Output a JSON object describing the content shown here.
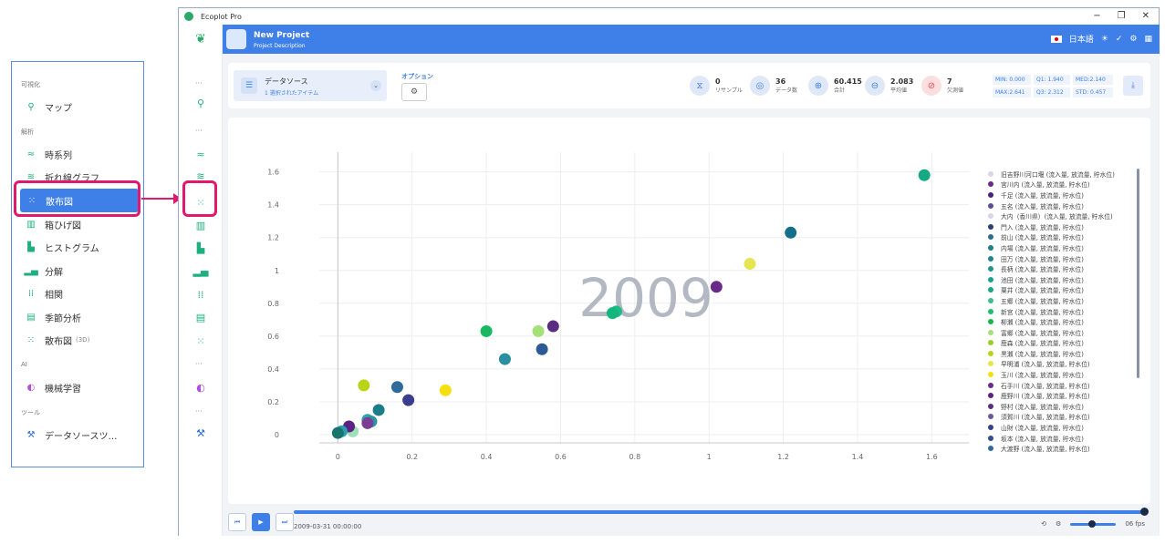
{
  "callout_menu": {
    "sections": [
      {
        "label": "可視化",
        "items": [
          {
            "label": "マップ",
            "icon": "map-pin-icon"
          }
        ]
      },
      {
        "label": "解析",
        "items": [
          {
            "label": "時系列",
            "icon": "timeseries-icon"
          },
          {
            "label": "折れ線グラフ",
            "icon": "line-chart-icon"
          },
          {
            "label": "散布図",
            "icon": "scatter-icon",
            "active": true
          },
          {
            "label": "箱ひげ図",
            "icon": "boxplot-icon"
          },
          {
            "label": "ヒストグラム",
            "icon": "histogram-icon"
          },
          {
            "label": "分解",
            "icon": "decompose-icon"
          },
          {
            "label": "相関",
            "icon": "correlation-icon"
          },
          {
            "label": "季節分析",
            "icon": "seasonal-icon"
          },
          {
            "label": "散布図",
            "sub": "(3D)",
            "icon": "scatter3d-icon"
          }
        ]
      },
      {
        "label": "AI",
        "items": [
          {
            "label": "機械学習",
            "icon": "ml-icon"
          }
        ]
      },
      {
        "label": "ツール",
        "items": [
          {
            "label": "データソースツ…",
            "icon": "tools-icon"
          }
        ]
      }
    ]
  },
  "window": {
    "title": "Ecoplot Pro",
    "controls": [
      "−",
      "❐",
      "✕"
    ]
  },
  "header": {
    "project_title": "New Project",
    "project_desc": "Project Description",
    "language": "日本語"
  },
  "toolbar": {
    "datasource_label": "データソース",
    "datasource_sub": "1 選択されたアイテム",
    "options_label": "オプション",
    "stats": [
      {
        "value": "0",
        "label": "リサンプル",
        "icon": "resample-icon"
      },
      {
        "value": "36",
        "label": "データ数",
        "icon": "count-icon"
      },
      {
        "value": "60.415",
        "label": "合計",
        "icon": "sum-icon"
      },
      {
        "value": "2.083",
        "label": "平均値",
        "icon": "mean-icon"
      },
      {
        "value": "7",
        "label": "欠測値",
        "icon": "missing-icon"
      }
    ],
    "metrics": [
      "MIN: 0.000",
      "Q1: 1.940",
      "MED:2.140",
      "MAX:2.641",
      "Q3: 2.312",
      "STD: 0.457"
    ]
  },
  "chart_data": {
    "type": "scatter",
    "annotation": "2009",
    "xlim": [
      -0.05,
      1.7
    ],
    "ylim": [
      -0.05,
      1.72
    ],
    "xticks": [
      0,
      0.2,
      0.4,
      0.6,
      0.8,
      1,
      1.2,
      1.4,
      1.6
    ],
    "yticks": [
      0,
      0.2,
      0.4,
      0.6,
      0.8,
      1,
      1.2,
      1.4,
      1.6
    ],
    "points": [
      {
        "x": 1.58,
        "y": 1.58,
        "color": "#17a884"
      },
      {
        "x": 1.22,
        "y": 1.23,
        "color": "#14708a"
      },
      {
        "x": 1.11,
        "y": 1.04,
        "color": "#e3e651"
      },
      {
        "x": 1.02,
        "y": 0.9,
        "color": "#6a2a8a"
      },
      {
        "x": 0.75,
        "y": 0.75,
        "color": "#1ebd87"
      },
      {
        "x": 0.74,
        "y": 0.74,
        "color": "#14b67e"
      },
      {
        "x": 0.58,
        "y": 0.66,
        "color": "#5a2d82"
      },
      {
        "x": 0.54,
        "y": 0.63,
        "color": "#a6e07a"
      },
      {
        "x": 0.4,
        "y": 0.63,
        "color": "#19b863"
      },
      {
        "x": 0.55,
        "y": 0.52,
        "color": "#2d5a94"
      },
      {
        "x": 0.45,
        "y": 0.46,
        "color": "#b7dc4f"
      },
      {
        "x": 0.45,
        "y": 0.46,
        "color": "#2a8fa0"
      },
      {
        "x": 0.29,
        "y": 0.27,
        "color": "#f6df0f"
      },
      {
        "x": 0.07,
        "y": 0.3,
        "color": "#b9d417"
      },
      {
        "x": 0.16,
        "y": 0.29,
        "color": "#2f6a9a"
      },
      {
        "x": 0.19,
        "y": 0.21,
        "color": "#3b3e8f"
      },
      {
        "x": 0.11,
        "y": 0.15,
        "color": "#1b7d8a"
      },
      {
        "x": 0.08,
        "y": 0.09,
        "color": "#32a4a8"
      },
      {
        "x": 0.09,
        "y": 0.08,
        "color": "#2c93a5"
      },
      {
        "x": 0.08,
        "y": 0.07,
        "color": "#7a3f95"
      },
      {
        "x": 0.04,
        "y": 0.02,
        "color": "#9ce0b8"
      },
      {
        "x": 0.03,
        "y": 0.05,
        "color": "#5c2283"
      },
      {
        "x": 0.01,
        "y": 0.02,
        "color": "#2b9db2"
      },
      {
        "x": 0.0,
        "y": 0.01,
        "color": "#17756c"
      }
    ],
    "legend": [
      {
        "name": "旧吉野川河口堰 (流入量, 放流量, 貯水位)",
        "color": "#dcd3e8"
      },
      {
        "name": "宮川内 (流入量, 放流量, 貯水位)",
        "color": "#6a2a8a"
      },
      {
        "name": "千足 (流入量, 放流量, 貯水位)",
        "color": "#4b2180"
      },
      {
        "name": "五名 (流入量, 放流量, 貯水位)",
        "color": "#5b4e92"
      },
      {
        "name": "大内（香川県）(流入量, 放流量, 貯水位)",
        "color": "#dcd3e8"
      },
      {
        "name": "門入 (流入量, 放流量, 貯水位)",
        "color": "#2d3f6e"
      },
      {
        "name": "前山 (流入量, 放流量, 貯水位)",
        "color": "#2e6a94"
      },
      {
        "name": "内場 (流入量, 放流量, 貯水位)",
        "color": "#1f7f8a"
      },
      {
        "name": "田万 (流入量, 放流量, 貯水位)",
        "color": "#1b8790"
      },
      {
        "name": "長柄 (流入量, 放流量, 貯水位)",
        "color": "#22958f"
      },
      {
        "name": "池田 (流入量, 放流量, 貯水位)",
        "color": "#1aa28a"
      },
      {
        "name": "粟井 (流入量, 放流量, 貯水位)",
        "color": "#17a884"
      },
      {
        "name": "五郷 (流入量, 放流量, 貯水位)",
        "color": "#3cbf8a"
      },
      {
        "name": "新宮 (流入量, 放流量, 貯水位)",
        "color": "#1ebd6f"
      },
      {
        "name": "柳瀬 (流入量, 放流量, 貯水位)",
        "color": "#17b54f"
      },
      {
        "name": "富郷 (流入量, 放流量, 貯水位)",
        "color": "#a6e07a"
      },
      {
        "name": "鹿森 (流入量, 放流量, 貯水位)",
        "color": "#9ad021"
      },
      {
        "name": "黒瀬 (流入量, 放流量, 貯水位)",
        "color": "#b9d417"
      },
      {
        "name": "早明浦 (流入量, 放流量, 貯水位)",
        "color": "#e3e651"
      },
      {
        "name": "玉川 (流入量, 放流量, 貯水位)",
        "color": "#f6df0f"
      },
      {
        "name": "石手川 (流入量, 放流量, 貯水位)",
        "color": "#6a2a8a"
      },
      {
        "name": "鹿野川 (流入量, 放流量, 貯水位)",
        "color": "#5c2283"
      },
      {
        "name": "野村 (流入量, 放流量, 貯水位)",
        "color": "#5a2d82"
      },
      {
        "name": "須賀川 (流入量, 放流量, 貯水位)",
        "color": "#6a5a9a"
      },
      {
        "name": "山財 (流入量, 放流量, 貯水位)",
        "color": "#3b3e8f"
      },
      {
        "name": "坂本 (流入量, 放流量, 貯水位)",
        "color": "#2f4f86"
      },
      {
        "name": "大渡野 (流入量, 放流量, 貯水位)",
        "color": "#2f6a9a"
      }
    ]
  },
  "player": {
    "time": "2009-03-31 00:00:00",
    "fps": "06 fps",
    "progress": 1.0
  }
}
